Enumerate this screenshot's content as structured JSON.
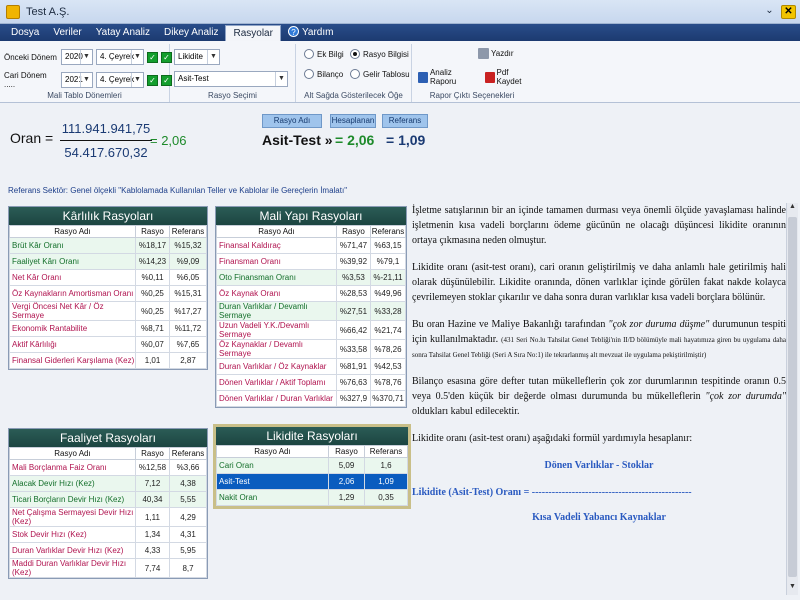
{
  "window": {
    "title": "Test A.Ş."
  },
  "menu": [
    "Dosya",
    "Veriler",
    "Yatay Analiz",
    "Dikey Analiz",
    "Rasyolar",
    "Yardım"
  ],
  "ribbon": {
    "group1": {
      "label": "Mali Tablo Dönemleri",
      "prev_label": "Önceki Dönem",
      "prev_year": "2020",
      "prev_quarter": "4. Çeyrek",
      "curr_label": "Cari Dönem .....",
      "curr_year": "2021",
      "curr_quarter": "4. Çeyrek"
    },
    "group2": {
      "label": "Rasyo Seçimi",
      "category": "Likidite",
      "ratio": "Asit-Test"
    },
    "group3": {
      "label": "Alt Sağda Gösterilecek Öğe",
      "opt1": "Ek Bilgi",
      "opt2": "Rasyo Bilgisi",
      "opt3": "Bilanço",
      "opt4": "Gelir Tablosu"
    },
    "group4": {
      "label": "Rapor Çıktı Seçenekleri",
      "print": "Yazdır",
      "analysis": "Analiz Raporu",
      "pdf": "Pdf Kaydet"
    }
  },
  "oran": {
    "label": "Oran =",
    "numerator": "111.941.941,75",
    "denominator": "54.417.670,32",
    "result": "= 2,06",
    "headers": [
      "Rasyo Adı",
      "Hesaplanan",
      "Referans"
    ],
    "name": "Asit-Test »",
    "calculated": "= 2,06",
    "reference": "= 1,09"
  },
  "ref_sector": "Referans Sektör: Genel ölçekli \"Kablolamada Kullanılan Teller ve Kablolar ile Gereçlerin İmalatı\"",
  "columns": {
    "name": "Rasyo Adı",
    "ratio": "Rasyo",
    "ref": "Referans"
  },
  "karlilik": {
    "title": "Kârlılık Rasyoları",
    "rows": [
      {
        "name": "Brüt Kâr Oranı",
        "r": "%18,17",
        "ref": "%15,32",
        "c": "g"
      },
      {
        "name": "Faaliyet Kârı Oranı",
        "r": "%14,23",
        "ref": "%9,09",
        "c": "g"
      },
      {
        "name": "Net Kâr Oranı",
        "r": "%0,11",
        "ref": "%6,05",
        "c": "p"
      },
      {
        "name": "Öz Kaynakların Amortisman Oranı",
        "r": "%0,25",
        "ref": "%15,31",
        "c": "p"
      },
      {
        "name": "Vergi Öncesi Net Kâr / Öz Sermaye",
        "r": "%0,25",
        "ref": "%17,27",
        "c": "p"
      },
      {
        "name": "Ekonomik Rantabilite",
        "r": "%8,71",
        "ref": "%11,72",
        "c": "p"
      },
      {
        "name": "Aktif Kârlılığı",
        "r": "%0,07",
        "ref": "%7,65",
        "c": "p"
      },
      {
        "name": "Finansal Giderleri Karşılama (Kez)",
        "r": "1,01",
        "ref": "2,87",
        "c": "p"
      }
    ]
  },
  "mali": {
    "title": "Mali Yapı Rasyoları",
    "rows": [
      {
        "name": "Finansal Kaldıraç",
        "r": "%71,47",
        "ref": "%63,15",
        "c": "p"
      },
      {
        "name": "Finansman Oranı",
        "r": "%39,92",
        "ref": "%79,1",
        "c": "p"
      },
      {
        "name": "Oto Finansman Oranı",
        "r": "%3,53",
        "ref": "%-21,11",
        "c": "g"
      },
      {
        "name": "Öz Kaynak Oranı",
        "r": "%28,53",
        "ref": "%49,96",
        "c": "p"
      },
      {
        "name": "Duran Varlıklar / Devamlı Sermaye",
        "r": "%27,51",
        "ref": "%33,28",
        "c": "g"
      },
      {
        "name": "Uzun Vadeli Y.K./Devamlı Sermaye",
        "r": "%66,42",
        "ref": "%21,74",
        "c": "p"
      },
      {
        "name": "Öz Kaynaklar / Devamlı Sermaye",
        "r": "%33,58",
        "ref": "%78,26",
        "c": "p"
      },
      {
        "name": "Duran Varlıklar / Öz Kaynaklar",
        "r": "%81,91",
        "ref": "%42,53",
        "c": "p"
      },
      {
        "name": "Dönen Varlıklar / Aktif Toplamı",
        "r": "%76,63",
        "ref": "%78,76",
        "c": "p"
      },
      {
        "name": "Dönen Varlıklar / Duran Varlıklar",
        "r": "%327,9",
        "ref": "%370,71",
        "c": "p"
      }
    ]
  },
  "faaliyet": {
    "title": "Faaliyet Rasyoları",
    "rows": [
      {
        "name": "Mali Borçlanma Faiz Oranı",
        "r": "%12,58",
        "ref": "%3,66",
        "c": "p"
      },
      {
        "name": "Alacak Devir Hızı (Kez)",
        "r": "7,12",
        "ref": "4,38",
        "c": "g"
      },
      {
        "name": "Ticari Borçların Devir Hızı (Kez)",
        "r": "40,34",
        "ref": "5,55",
        "c": "g"
      },
      {
        "name": "Net Çalışma Sermayesi Devir Hızı (Kez)",
        "r": "1,11",
        "ref": "4,29",
        "c": "p"
      },
      {
        "name": "Stok Devir Hızı (Kez)",
        "r": "1,34",
        "ref": "4,31",
        "c": "p"
      },
      {
        "name": "Duran Varlıklar Devir Hızı (Kez)",
        "r": "4,33",
        "ref": "5,95",
        "c": "p"
      },
      {
        "name": "Maddi Duran Varlıklar Devir Hızı (Kez)",
        "r": "7,74",
        "ref": "8,7",
        "c": "p"
      }
    ]
  },
  "likidite": {
    "title": "Likidite Rasyoları",
    "rows": [
      {
        "name": "Cari Oran",
        "r": "5,09",
        "ref": "1,6",
        "c": "g"
      },
      {
        "name": "Asit-Test",
        "r": "2,06",
        "ref": "1,09",
        "c": "g",
        "selected": true
      },
      {
        "name": "Nakit Oran",
        "r": "1,29",
        "ref": "0,35",
        "c": "g"
      }
    ]
  },
  "info": {
    "p1": "İşletme satışlarının bir an içinde tamamen durması veya önemli ölçüde yavaşlaması halinde işletmenin kısa vadeli borçlarını ödeme gücünün ne olacağı düşüncesi likidite oranının ortaya çıkmasına neden olmuştur.",
    "p2": "Likidite oranı (asit-test oranı), cari oranın geliştirilmiş ve daha anlamlı hale getirilmiş hali olarak düşünülebilir. Likidite oranında, dönen varlıklar içinde görülen fakat nakde kolayca çevrilemeyen stoklar çıkarılır ve daha sonra duran varlıklar kısa vadeli borçlara bölünür.",
    "p3a": "Bu oran Hazine ve Maliye Bakanlığı tarafından",
    "p3b": "\"çok zor duruma düşme\"",
    "p3c": "durumunun tespiti için kullanılmaktadır.",
    "p3d": "(431 Seri No.lu Tahsilat Genel Tebliği'nin II/D bölümüyle mali hayatımıza giren bu uygulama daha sonra Tahsilat Genel Tebliği (Seri A Sıra No:1) ile tekrarlanmış alt mevzuat ile uygulama pekiştirilmiştir)",
    "p4a": "Bilanço esasına göre defter tutan mükelleflerin çok zor durumlarının tespitinde oranın 0.5 veya 0.5'den küçük bir değerde olması durumunda bu mükelleflerin",
    "p4b": "\"çok zor durumda\"",
    "p4c": "oldukları kabul edilecektir.",
    "p5": "Likidite oranı (asit-test oranı) aşağıdaki formül yardımıyla hesaplanır:",
    "f_top": "Dönen Varlıklar - Stoklar",
    "f_mid": "Likidite (Asit-Test) Oranı = ------------------------------------------------",
    "f_bot": "Kısa Vadeli Yabancı Kaynaklar"
  }
}
